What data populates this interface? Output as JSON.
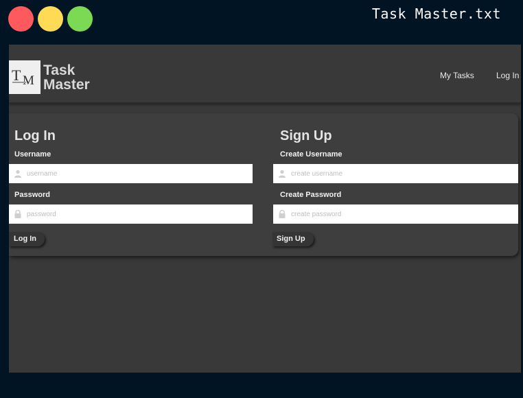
{
  "window": {
    "title": "Task Master.txt",
    "controls": [
      "close",
      "minimize",
      "maximize"
    ]
  },
  "navbar": {
    "logo_text": "TM",
    "brand_line1": "Task",
    "brand_line2": "Master",
    "links": {
      "my_tasks": "My Tasks",
      "log_in": "Log In"
    }
  },
  "login": {
    "title": "Log In",
    "username_label": "Username",
    "username_placeholder": "username",
    "password_label": "Password",
    "password_placeholder": "password",
    "button": "Log In"
  },
  "signup": {
    "title": "Sign Up",
    "username_label": "Create Username",
    "username_placeholder": "create username",
    "password_label": "Create Password",
    "password_placeholder": "create password",
    "button": "Sign Up"
  },
  "icons": {
    "username_field": "user-icon",
    "password_field": "lock-icon"
  },
  "colors": {
    "close": "#fe5a5d",
    "minimize": "#ffdb55",
    "maximize": "#7bd954",
    "background": "#011423",
    "app_bg": "#393939",
    "panel_bg": "#3e3e3e"
  }
}
